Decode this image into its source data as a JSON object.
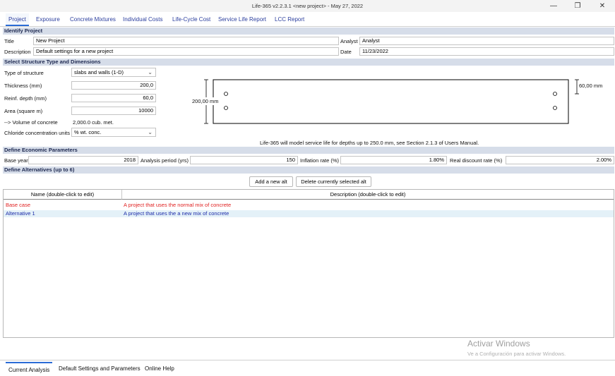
{
  "window": {
    "title": "Life-365 v2.2.3.1 <new project> -  May 27, 2022",
    "min_icon": "minimize-icon",
    "max_icon": "maximize-icon",
    "close_icon": "close-icon"
  },
  "tabs": [
    {
      "label": "Project"
    },
    {
      "label": "Exposure"
    },
    {
      "label": "Concrete Mixtures"
    },
    {
      "label": "Individual Costs"
    },
    {
      "label": "Life-Cycle Cost"
    },
    {
      "label": "Service Life Report"
    },
    {
      "label": "LCC Report"
    }
  ],
  "identify": {
    "header": "Identify Project",
    "title_label": "Title",
    "title_value": "New Project",
    "analyst_label": "Analyst",
    "analyst_value": "Analyst",
    "desc_label": "Description",
    "desc_value": "Default settings for a new project",
    "date_label": "Date",
    "date_value": "11/23/2022"
  },
  "structure": {
    "header": "Select Structure Type and Dimensions",
    "type_label": "Type of structure",
    "type_value": "slabs and walls (1-D)",
    "thickness_label": "Thickness (mm)",
    "thickness_value": "200,0",
    "reinf_label": "Reinf. depth (mm)",
    "reinf_value": "60,0",
    "area_label": "Area (square m)",
    "area_value": "10000",
    "volume_label": "--> Volume of concrete",
    "volume_value": "2,000.0 cub. met.",
    "chloride_label": "Chloride concentration units",
    "chloride_value": "% wt. conc.",
    "diagram_thickness": "200,00 mm",
    "diagram_depth": "60,00 mm",
    "note": "Life-365 will model service life for depths up to 250.0 mm, see Section 2.1.3 of Users Manual."
  },
  "economic": {
    "header": "Define Economic Parameters",
    "base_year_label": "Base year",
    "base_year_value": "2018",
    "period_label": "Analysis period (yrs)",
    "period_value": "150",
    "inflation_label": "Inflation rate (%)",
    "inflation_value": "1.80%",
    "discount_label": "Real discount rate (%)",
    "discount_value": "2.00%"
  },
  "alternatives": {
    "header": "Define Alternatives (up to 6)",
    "add_button": "Add a new alt",
    "delete_button": "Delete currently selected alt",
    "col_name": "Name (double-click to edit)",
    "col_desc": "Description (double-click to edit)",
    "rows": [
      {
        "name": "Base case",
        "desc": "A project that uses the normal mix of concrete",
        "color": "#e02020"
      },
      {
        "name": "Alternative 1",
        "desc": "A project that uses the a new mix of concrete",
        "color": "#1a2aa8"
      }
    ]
  },
  "watermark": {
    "line1": "Activar Windows",
    "line2": "Ve a Configuración para activar Windows."
  },
  "bottom_tabs": [
    {
      "label": "Current Analysis"
    },
    {
      "label": "Default Settings and Parameters"
    },
    {
      "label": "Online Help"
    }
  ]
}
